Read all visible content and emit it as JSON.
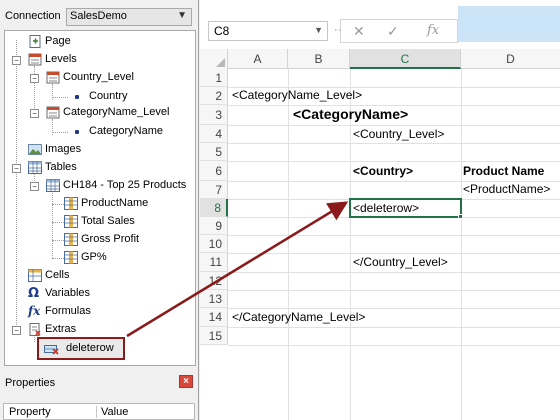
{
  "connection": {
    "label": "Connection",
    "selected": "SalesDemo"
  },
  "tree": {
    "page": "Page",
    "levels": "Levels",
    "country_level": "Country_Level",
    "country": "Country",
    "categoryname_level": "CategoryName_Level",
    "categoryname": "CategoryName",
    "images": "Images",
    "tables": "Tables",
    "table_name": "CH184 - Top 25 Products",
    "fields": [
      "ProductName",
      "Total Sales",
      "Gross Profit",
      "GP%"
    ],
    "cells": "Cells",
    "variables": "Variables",
    "formulas": "Formulas",
    "extras": "Extras",
    "deleterow": "deleterow"
  },
  "properties": {
    "title": "Properties",
    "col_property": "Property",
    "col_value": "Value"
  },
  "sheet": {
    "namebox": "C8",
    "columns": [
      "A",
      "B",
      "C",
      "D"
    ],
    "rows": [
      "1",
      "2",
      "3",
      "4",
      "5",
      "6",
      "7",
      "8",
      "9",
      "10",
      "11",
      "12",
      "13",
      "14",
      "15"
    ],
    "cells": {
      "a2": "<CategoryName_Level>",
      "b3": "<CategoryName>",
      "c4": "<Country_Level>",
      "c6": "<Country>",
      "d6": "Product Name",
      "d7": "<ProductName>",
      "c8": "<deleterow>",
      "c11": "</Country_Level>",
      "a14": "</CategoryName_Level>"
    }
  },
  "colors": {
    "accent_green": "#217346",
    "callout_red": "#8b1a1a"
  }
}
